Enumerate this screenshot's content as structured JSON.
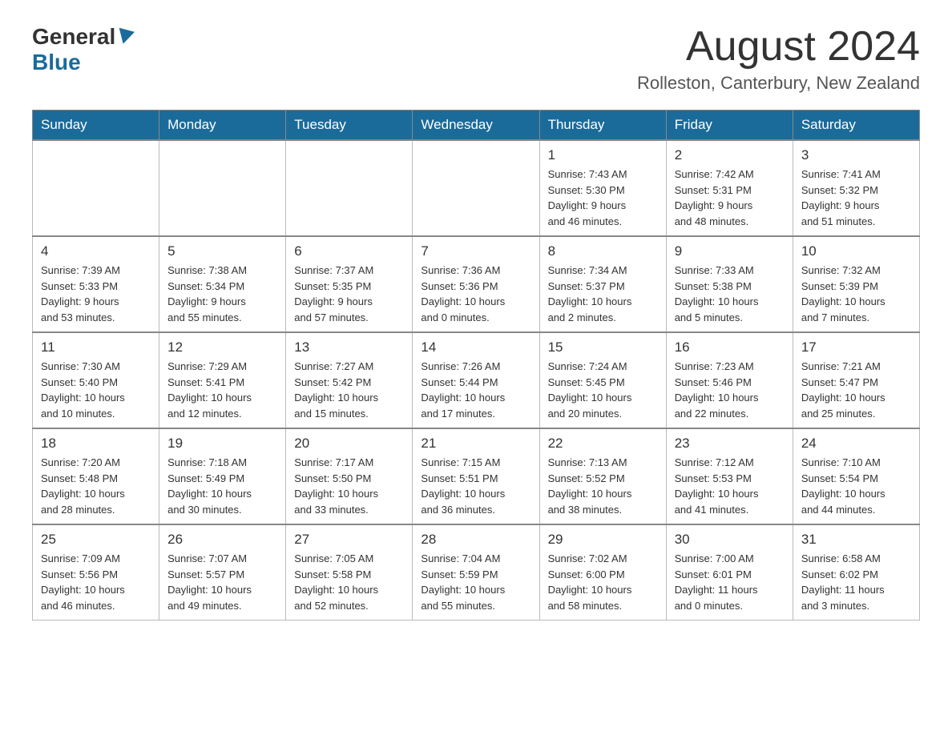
{
  "header": {
    "logo_general": "General",
    "logo_blue": "Blue",
    "month_title": "August 2024",
    "location": "Rolleston, Canterbury, New Zealand"
  },
  "days_of_week": [
    "Sunday",
    "Monday",
    "Tuesday",
    "Wednesday",
    "Thursday",
    "Friday",
    "Saturday"
  ],
  "weeks": [
    [
      {
        "day": "",
        "info": ""
      },
      {
        "day": "",
        "info": ""
      },
      {
        "day": "",
        "info": ""
      },
      {
        "day": "",
        "info": ""
      },
      {
        "day": "1",
        "info": "Sunrise: 7:43 AM\nSunset: 5:30 PM\nDaylight: 9 hours\nand 46 minutes."
      },
      {
        "day": "2",
        "info": "Sunrise: 7:42 AM\nSunset: 5:31 PM\nDaylight: 9 hours\nand 48 minutes."
      },
      {
        "day": "3",
        "info": "Sunrise: 7:41 AM\nSunset: 5:32 PM\nDaylight: 9 hours\nand 51 minutes."
      }
    ],
    [
      {
        "day": "4",
        "info": "Sunrise: 7:39 AM\nSunset: 5:33 PM\nDaylight: 9 hours\nand 53 minutes."
      },
      {
        "day": "5",
        "info": "Sunrise: 7:38 AM\nSunset: 5:34 PM\nDaylight: 9 hours\nand 55 minutes."
      },
      {
        "day": "6",
        "info": "Sunrise: 7:37 AM\nSunset: 5:35 PM\nDaylight: 9 hours\nand 57 minutes."
      },
      {
        "day": "7",
        "info": "Sunrise: 7:36 AM\nSunset: 5:36 PM\nDaylight: 10 hours\nand 0 minutes."
      },
      {
        "day": "8",
        "info": "Sunrise: 7:34 AM\nSunset: 5:37 PM\nDaylight: 10 hours\nand 2 minutes."
      },
      {
        "day": "9",
        "info": "Sunrise: 7:33 AM\nSunset: 5:38 PM\nDaylight: 10 hours\nand 5 minutes."
      },
      {
        "day": "10",
        "info": "Sunrise: 7:32 AM\nSunset: 5:39 PM\nDaylight: 10 hours\nand 7 minutes."
      }
    ],
    [
      {
        "day": "11",
        "info": "Sunrise: 7:30 AM\nSunset: 5:40 PM\nDaylight: 10 hours\nand 10 minutes."
      },
      {
        "day": "12",
        "info": "Sunrise: 7:29 AM\nSunset: 5:41 PM\nDaylight: 10 hours\nand 12 minutes."
      },
      {
        "day": "13",
        "info": "Sunrise: 7:27 AM\nSunset: 5:42 PM\nDaylight: 10 hours\nand 15 minutes."
      },
      {
        "day": "14",
        "info": "Sunrise: 7:26 AM\nSunset: 5:44 PM\nDaylight: 10 hours\nand 17 minutes."
      },
      {
        "day": "15",
        "info": "Sunrise: 7:24 AM\nSunset: 5:45 PM\nDaylight: 10 hours\nand 20 minutes."
      },
      {
        "day": "16",
        "info": "Sunrise: 7:23 AM\nSunset: 5:46 PM\nDaylight: 10 hours\nand 22 minutes."
      },
      {
        "day": "17",
        "info": "Sunrise: 7:21 AM\nSunset: 5:47 PM\nDaylight: 10 hours\nand 25 minutes."
      }
    ],
    [
      {
        "day": "18",
        "info": "Sunrise: 7:20 AM\nSunset: 5:48 PM\nDaylight: 10 hours\nand 28 minutes."
      },
      {
        "day": "19",
        "info": "Sunrise: 7:18 AM\nSunset: 5:49 PM\nDaylight: 10 hours\nand 30 minutes."
      },
      {
        "day": "20",
        "info": "Sunrise: 7:17 AM\nSunset: 5:50 PM\nDaylight: 10 hours\nand 33 minutes."
      },
      {
        "day": "21",
        "info": "Sunrise: 7:15 AM\nSunset: 5:51 PM\nDaylight: 10 hours\nand 36 minutes."
      },
      {
        "day": "22",
        "info": "Sunrise: 7:13 AM\nSunset: 5:52 PM\nDaylight: 10 hours\nand 38 minutes."
      },
      {
        "day": "23",
        "info": "Sunrise: 7:12 AM\nSunset: 5:53 PM\nDaylight: 10 hours\nand 41 minutes."
      },
      {
        "day": "24",
        "info": "Sunrise: 7:10 AM\nSunset: 5:54 PM\nDaylight: 10 hours\nand 44 minutes."
      }
    ],
    [
      {
        "day": "25",
        "info": "Sunrise: 7:09 AM\nSunset: 5:56 PM\nDaylight: 10 hours\nand 46 minutes."
      },
      {
        "day": "26",
        "info": "Sunrise: 7:07 AM\nSunset: 5:57 PM\nDaylight: 10 hours\nand 49 minutes."
      },
      {
        "day": "27",
        "info": "Sunrise: 7:05 AM\nSunset: 5:58 PM\nDaylight: 10 hours\nand 52 minutes."
      },
      {
        "day": "28",
        "info": "Sunrise: 7:04 AM\nSunset: 5:59 PM\nDaylight: 10 hours\nand 55 minutes."
      },
      {
        "day": "29",
        "info": "Sunrise: 7:02 AM\nSunset: 6:00 PM\nDaylight: 10 hours\nand 58 minutes."
      },
      {
        "day": "30",
        "info": "Sunrise: 7:00 AM\nSunset: 6:01 PM\nDaylight: 11 hours\nand 0 minutes."
      },
      {
        "day": "31",
        "info": "Sunrise: 6:58 AM\nSunset: 6:02 PM\nDaylight: 11 hours\nand 3 minutes."
      }
    ]
  ]
}
